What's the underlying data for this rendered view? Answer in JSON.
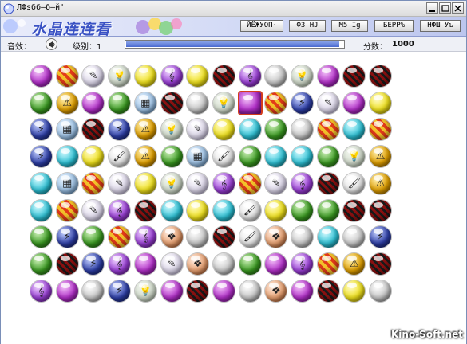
{
  "window": {
    "title": "ЛФsбб–б–й'"
  },
  "banner": {
    "logo": "水晶连连看",
    "buttons": [
      "ЙЁЖУОП·",
      "ФЗ НJ",
      "М5 Ig",
      "БЕРР%",
      "НФШ Уъ"
    ]
  },
  "status": {
    "sound_label": "音效：",
    "level_label": "级别：1",
    "score_label": "分数：",
    "score_value": "1000",
    "progress": 0.98
  },
  "board": {
    "rows": 9,
    "cols": 14,
    "selected": {
      "row": 1,
      "col": 8
    },
    "palette": {
      "P": {
        "bg": "radial-gradient(circle at 35% 30%, #f4c6f9, #b22fc9 55%, #6b0c80)",
        "glyph": ""
      },
      "S": {
        "bg": "repeating-linear-gradient(45deg, #e23a1a 0 4px, #f2c12a 4px 8px)",
        "glyph": ""
      },
      "N": {
        "bg": "radial-gradient(circle at 35% 30%, #fff, #dcd6ea 60%, #8f87a8)",
        "glyph": "✎"
      },
      "L": {
        "bg": "radial-gradient(circle at 35% 30%, #f3f7f0, #cfd9c9 60%, #7d8a78)",
        "glyph": "💡"
      },
      "Y": {
        "bg": "radial-gradient(circle at 35% 30%, #fffbd0, #f0e21c 55%, #9c8c00)",
        "glyph": ""
      },
      "V": {
        "bg": "radial-gradient(circle at 35% 30%, #f1d8ff, #9a3fd6 55%, #5a1480)",
        "glyph": "𝄞"
      },
      "W": {
        "bg": "repeating-linear-gradient(45deg, #8a1010 0 3px, #1a1a1a 3px 6px)",
        "glyph": ""
      },
      "G": {
        "bg": "radial-gradient(circle at 35% 30%, #ffffff, #c8c8c8 55%, #6f6f6f)",
        "glyph": ""
      },
      "R": {
        "bg": "radial-gradient(circle at 35% 30%, #d2f3bd, #3a9a21 55%, #1c5a0c)",
        "glyph": ""
      },
      "O": {
        "bg": "radial-gradient(circle at 35% 30%, #fff2b5, #e1a000 55%, #7a5000)",
        "glyph": "⚠"
      },
      "C": {
        "bg": "radial-gradient(circle at 35% 30%, #d8fbff, #2ec2d6 55%, #0b6b7a)",
        "glyph": ""
      },
      "B": {
        "bg": "radial-gradient(circle at 35% 30%, #c8d4ff, #2e3fa8 55%, #0c1555)",
        "glyph": "⚡"
      },
      "K": {
        "bg": "radial-gradient(circle at 35% 30%, #e8f4ff, #9fc3e6 55%, #3f6a92)",
        "glyph": "▦"
      },
      "Z": {
        "bg": "radial-gradient(circle at 35% 30%, #fff0e6, #e8a070 55%, #8a3c12)",
        "glyph": "❖"
      },
      "T": {
        "bg": "radial-gradient(circle at 35% 30%, #ffffff, #e7e7e7 55%, #888)",
        "glyph": "🖌"
      }
    },
    "tiles": [
      "PSNLYVYWVGLPWW",
      "ROPRKWGLPSBNPY",
      "BKWBOLNYCRGSCS",
      "BCYTORKTRCCRLO",
      "CKSNYLNVSNVWTO",
      "CSNVWCYCTYRRWW",
      "RBRSVZGWTZGCGB",
      "RWBVPNZGRPVSOW",
      "VPGBLPWPGZPWYG"
    ]
  },
  "watermark": "Kino-Soft.net"
}
